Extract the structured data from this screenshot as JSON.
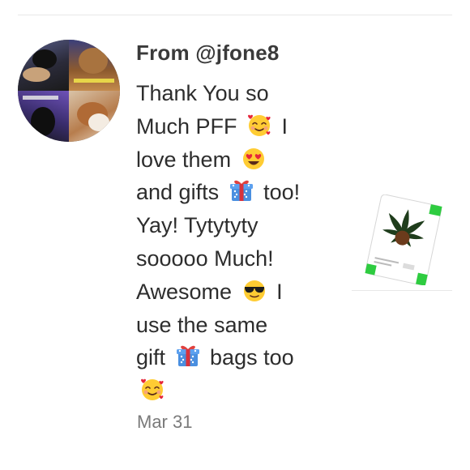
{
  "notification": {
    "from_label": "From @jfone8",
    "message_lines": [
      [
        "Thank You so",
        "",
        ""
      ],
      [
        "Much PFF ",
        "smiling-face-with-hearts",
        " I"
      ],
      [
        "love them ",
        "heart-eyes",
        ""
      ],
      [
        "and gifts ",
        "wrapped-gift",
        " too!"
      ],
      [
        "Yay! Tytytyty",
        "",
        ""
      ],
      [
        "sooooo Much!",
        "",
        ""
      ],
      [
        "Awesome ",
        "sunglasses-face",
        " I"
      ],
      [
        "use the same",
        "",
        ""
      ],
      [
        "gift ",
        "wrapped-gift",
        " bags too"
      ],
      [
        "",
        "smiling-face-with-hearts",
        ""
      ]
    ],
    "timestamp": "Mar 31",
    "avatar_icon": "avatar-collage-cats",
    "thumbnail_icon": "cannabis-leaf-card-thumbnail"
  },
  "colors": {
    "name_text": "#3a3a3a",
    "message_text": "#2d2d2d",
    "timestamp_text": "#7a7a7a",
    "divider": "#e8e8e8",
    "leaf_green": "#1f3d1c",
    "leaf_center": "#6b3b1c",
    "accent_green": "#2ecc40"
  }
}
